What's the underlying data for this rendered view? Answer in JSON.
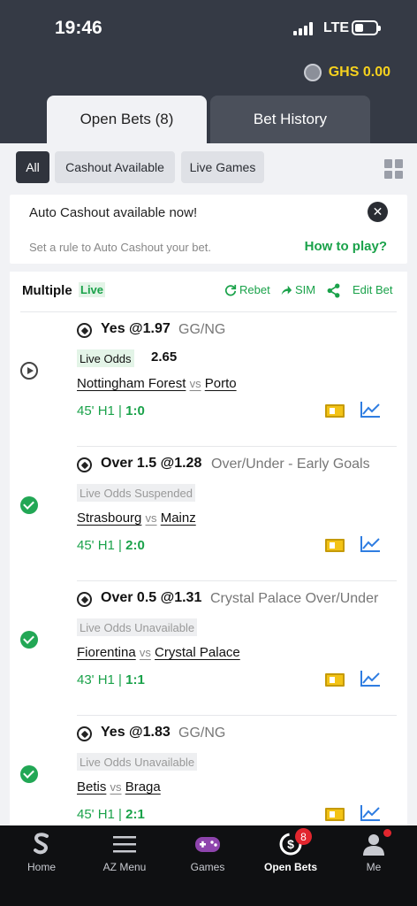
{
  "status_bar": {
    "time": "19:46",
    "network": "LTE"
  },
  "header": {
    "balance": "GHS 0.00",
    "tabs": [
      {
        "label": "Open Bets (8)",
        "active": true
      },
      {
        "label": "Bet History",
        "active": false
      }
    ]
  },
  "filters": {
    "all": "All",
    "cashout": "Cashout Available",
    "live_games": "Live Games"
  },
  "auto_cashout": {
    "title": "Auto Cashout available now!",
    "subtitle": "Set a rule to Auto Cashout your bet.",
    "link": "How to play?"
  },
  "bet": {
    "type": "Multiple",
    "live_tag": "Live",
    "actions": {
      "rebet": "Rebet",
      "sim": "SIM",
      "edit": "Edit Bet"
    },
    "selections": [
      {
        "pick": "Yes @1.97",
        "market": "GG/NG",
        "odds_label": "Live Odds",
        "odds_value": "2.65",
        "home": "Nottingham Forest",
        "vs": "vs",
        "away": "Porto",
        "time": "45' H1 | ",
        "score": "1:0",
        "status": "live"
      },
      {
        "pick": "Over 1.5 @1.28",
        "market": "Over/Under  -  Early Goals",
        "odds_label": "Live Odds Suspended",
        "home": "Strasbourg",
        "vs": "vs",
        "away": "Mainz",
        "time": "45' H1 | ",
        "score": "2:0",
        "status": "won"
      },
      {
        "pick": "Over 0.5 @1.31",
        "market": "Crystal Palace Over/Under",
        "odds_label": "Live Odds Unavailable",
        "home": "Fiorentina",
        "vs": "vs",
        "away": "Crystal Palace",
        "time": "43' H1 | ",
        "score": "1:1",
        "status": "won"
      },
      {
        "pick": "Yes @1.83",
        "market": "GG/NG",
        "odds_label": "Live Odds Unavailable",
        "home": "Betis",
        "vs": "vs",
        "away": "Braga",
        "time": "45' H1 | ",
        "score": "2:1",
        "status": "won"
      }
    ]
  },
  "bottom_nav": {
    "items": [
      {
        "label": "Home",
        "icon": "sporty-logo-icon"
      },
      {
        "label": "AZ Menu",
        "icon": "menu-icon"
      },
      {
        "label": "Games",
        "icon": "gamepad-icon"
      },
      {
        "label": "Open Bets",
        "icon": "open-bets-icon",
        "badge": "8",
        "active": true
      },
      {
        "label": "Me",
        "icon": "user-icon"
      }
    ]
  },
  "colors": {
    "header_bg": "#353a45",
    "accent_green": "#1aa24a",
    "balance_yellow": "#f7d21e",
    "badge_red": "#e2262e"
  }
}
